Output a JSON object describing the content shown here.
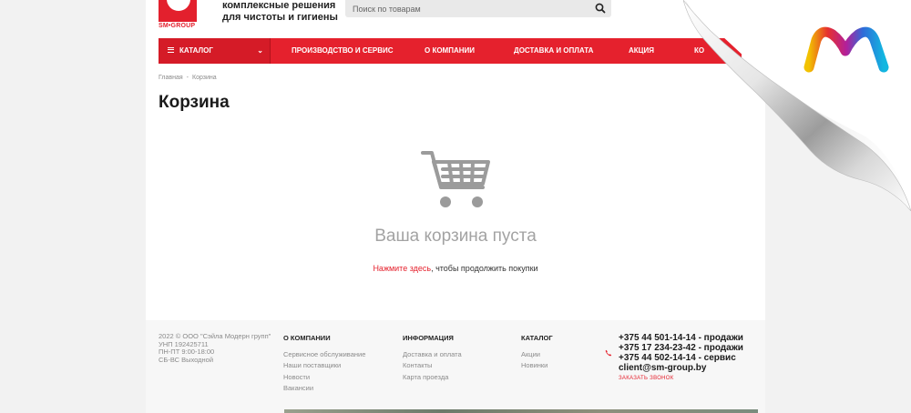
{
  "header": {
    "logo_text": "SM•GROUP",
    "tagline_line1": "комплексные решения",
    "tagline_line2": "для чистоты и гигиены",
    "search_placeholder": "Поиск по товарам"
  },
  "nav": {
    "catalog_label": "КАТАЛОГ",
    "items": [
      "ПРОИЗВОДСТВО И СЕРВИС",
      "О КОМПАНИИ",
      "ДОСТАВКА И ОПЛАТА",
      "АКЦИЯ",
      "КО"
    ]
  },
  "breadcrumb": [
    "Главная",
    "-",
    "Корзина"
  ],
  "page_title": "Корзина",
  "cart": {
    "empty_title": "Ваша корзина пуста",
    "link_text": "Нажмите здесь",
    "continue_text": ", чтобы продолжить покупки"
  },
  "footer": {
    "company_info": [
      "2022 © ООО \"Сэйла Модерн групп\"",
      "УНП 192425711",
      "ПН-ПТ 9:00-18:00",
      "СБ-ВС Выходной"
    ],
    "columns": [
      {
        "heading": "О КОМПАНИИ",
        "links": [
          "Сервисное обслуживание",
          "Наши поставщики",
          "Новости",
          "Вакансии"
        ]
      },
      {
        "heading": "ИНФОРМАЦИЯ",
        "links": [
          "Доставка и оплата",
          "Контакты",
          "Карта проезда"
        ]
      },
      {
        "heading": "КАТАЛОГ",
        "links": [
          "Акции",
          "Новинки"
        ]
      }
    ],
    "phones": [
      "+375 44 501-14-14 - продажи",
      "+375 17 234-23-42 - продажи",
      "+375 44 502-14-14 - сервис"
    ],
    "email": "client@sm-group.by",
    "callback_label": "ЗАКАЗАТЬ ЗВОНОК"
  },
  "colors": {
    "brand_red": "#e5212d",
    "background": "#f2f2f2",
    "muted_text": "#a3a3a3"
  },
  "icons": [
    "search-icon",
    "menu-icon",
    "chevron-down-icon",
    "shopping-cart-icon",
    "phone-icon",
    "m-logo-icon",
    "page-curl"
  ]
}
